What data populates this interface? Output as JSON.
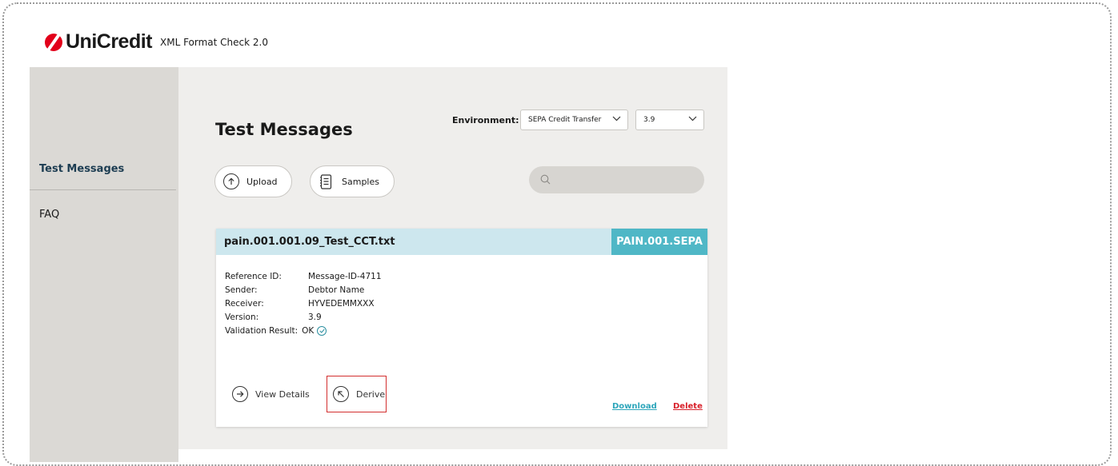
{
  "header": {
    "brand": "UniCredit",
    "app_title": "XML Format Check 2.0"
  },
  "sidebar": {
    "items": [
      {
        "label": "Test Messages",
        "active": true
      },
      {
        "label": "FAQ",
        "active": false
      }
    ]
  },
  "main": {
    "title": "Test Messages",
    "environment_label": "Environment:",
    "environment_value": "SEPA Credit Transfer",
    "version_value": "3.9",
    "upload_label": "Upload",
    "samples_label": "Samples",
    "search_placeholder": ""
  },
  "card": {
    "filename": "pain.001.001.09_Test_CCT.txt",
    "type": "PAIN.001.SEPA",
    "fields": [
      {
        "key": "Reference ID:",
        "value": "Message-ID-4711"
      },
      {
        "key": "Sender:",
        "value": "Debtor Name"
      },
      {
        "key": "Receiver:",
        "value": "HYVEDEMMXXX"
      },
      {
        "key": "Version:",
        "value": "3.9"
      },
      {
        "key": "Validation Result:",
        "value": "OK"
      }
    ],
    "view_details_label": "View Details",
    "derive_label": "Derive",
    "download_label": "Download",
    "delete_label": "Delete"
  },
  "colors": {
    "brand_red": "#e2001a",
    "accent_teal": "#4fb7c6",
    "delete_red": "#d8202a",
    "link_teal": "#2ea6bb"
  },
  "icons": {
    "upload": "arrow-up-circle-icon",
    "samples": "document-list-icon",
    "search": "search-icon",
    "view_details": "arrow-right-circle-icon",
    "derive": "arrow-up-left-circle-icon",
    "validation_ok": "check-circle-icon"
  }
}
